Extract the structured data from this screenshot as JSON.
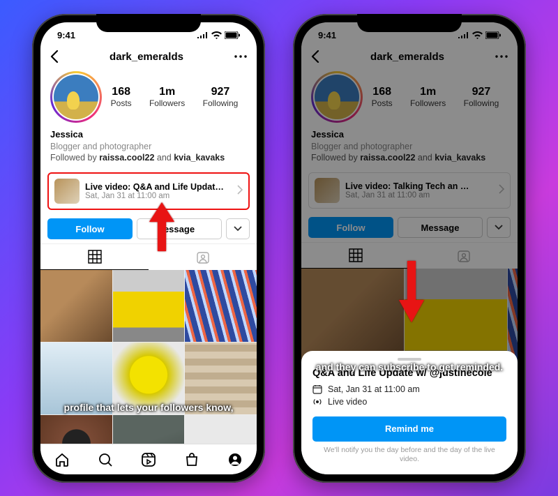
{
  "status": {
    "time": "9:41"
  },
  "header": {
    "username": "dark_emeralds"
  },
  "stats": {
    "posts": {
      "num": "168",
      "label": "Posts"
    },
    "followers": {
      "num": "1m",
      "label": "Followers"
    },
    "following": {
      "num": "927",
      "label": "Following"
    }
  },
  "bio": {
    "name": "Jessica",
    "title": "Blogger and photographer",
    "followed_prefix": "Followed by ",
    "followed_1": "raissa.cool22",
    "followed_and": " and ",
    "followed_2": "kvia_kavaks"
  },
  "live_left": {
    "title": "Live video: Q&A and Life Updat…",
    "date": "Sat, Jan 31 at 11:00 am"
  },
  "live_right": {
    "title": "Live video: Talking Tech an …",
    "date": "Sat, Jan 31 at 11:00 am"
  },
  "actions": {
    "follow": "Follow",
    "message": "Message",
    "message_partial": "essage"
  },
  "captions": {
    "left": "profile that lets your followers know,",
    "right": "and they can subscribe to get reminded."
  },
  "sheet": {
    "title": "Q&A and Life Update w/ @justinecole",
    "date": "Sat, Jan 31 at 11:00 am",
    "type": "Live video",
    "remind": "Remind me",
    "note": "We'll notify you the day before and the day of the live video."
  }
}
